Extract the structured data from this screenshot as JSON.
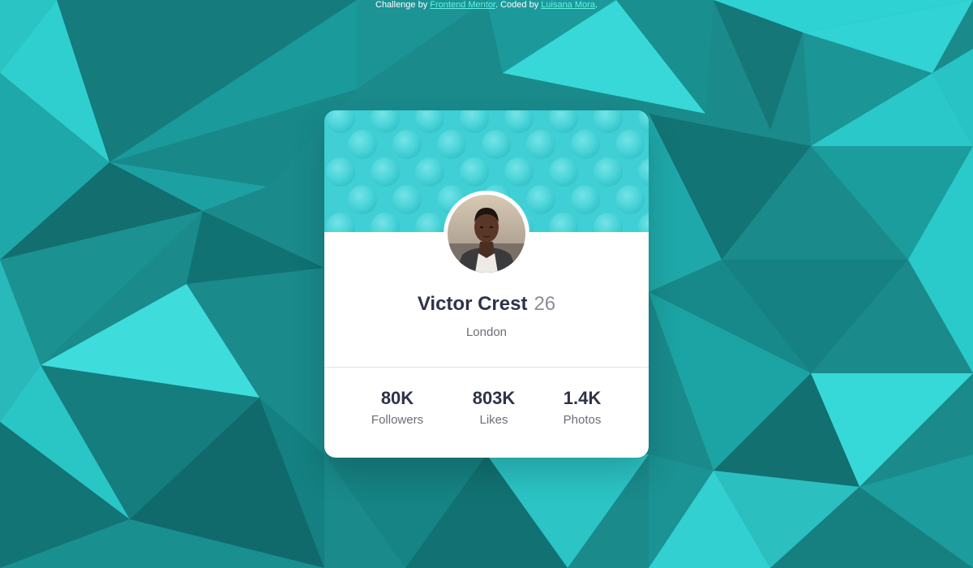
{
  "attribution": {
    "prefix": "Challenge by ",
    "challenge_link": "Frontend Mentor",
    "middle": ". Coded by ",
    "author_link": "Luisana Mora",
    "suffix": "."
  },
  "profile": {
    "name": "Victor Crest",
    "age": "26",
    "location": "London"
  },
  "stats": [
    {
      "value": "80K",
      "label": "Followers"
    },
    {
      "value": "803K",
      "label": "Likes"
    },
    {
      "value": "1.4K",
      "label": "Photos"
    }
  ],
  "colors": {
    "background": "#1b8e8f",
    "banner": "#3fcfd4",
    "card": "#ffffff",
    "primary_text": "#2e3349",
    "secondary_text": "#6b6e78",
    "link": "#62f2e6"
  }
}
